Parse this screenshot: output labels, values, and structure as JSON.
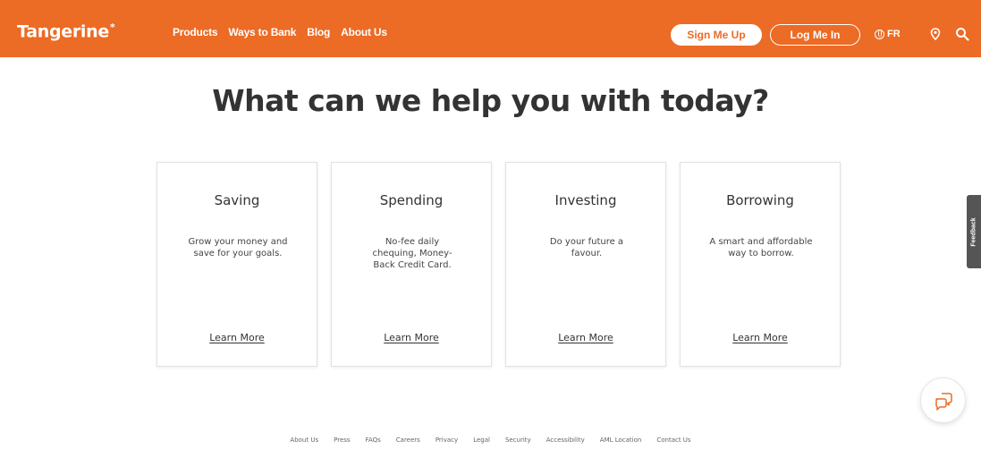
{
  "header": {
    "logo": "Tangerine",
    "logo_mark": "*",
    "nav": [
      "Products",
      "Ways to Bank",
      "Blog",
      "About Us"
    ],
    "signup_label": "Sign Me Up",
    "login_label": "Log Me In",
    "lang_label": "FR",
    "brand_color": "#ec6b25"
  },
  "main": {
    "headline": "What can we help you with today?",
    "cards": [
      {
        "title": "Saving",
        "description": "Grow your money and save for your goals.",
        "link": "Learn More"
      },
      {
        "title": "Spending",
        "description": "No-fee daily chequing, Money-Back Credit Card.",
        "link": "Learn More"
      },
      {
        "title": "Investing",
        "description": "Do your future a favour.",
        "link": "Learn More"
      },
      {
        "title": "Borrowing",
        "description": "A smart and affordable way to borrow.",
        "link": "Learn More"
      }
    ]
  },
  "feedback_tab": {
    "label": "Feedback"
  },
  "footer": {
    "links": [
      "About Us",
      "Press",
      "FAQs",
      "Careers",
      "Privacy",
      "Legal",
      "Security",
      "Accessibility",
      "AML Location",
      "Contact Us"
    ]
  }
}
